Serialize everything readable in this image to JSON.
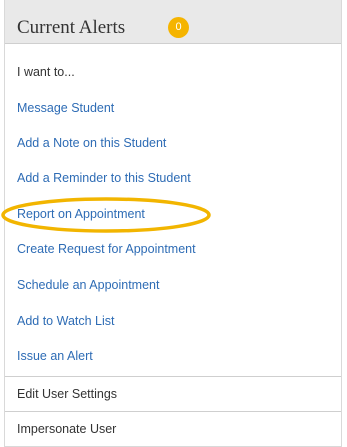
{
  "header": {
    "title": "Current Alerts",
    "alert_count": "0",
    "badge_color": "#f5b400"
  },
  "menu": {
    "heading": "I want to...",
    "items": [
      {
        "label": "Message Student"
      },
      {
        "label": "Add a Note on this Student"
      },
      {
        "label": "Add a Reminder to this Student"
      },
      {
        "label": "Report on Appointment",
        "highlighted": true
      },
      {
        "label": "Create Request for Appointment"
      },
      {
        "label": "Schedule an Appointment"
      },
      {
        "label": "Add to Watch List"
      },
      {
        "label": "Issue an Alert"
      }
    ]
  },
  "footer": {
    "items": [
      {
        "label": "Edit User Settings"
      },
      {
        "label": "Impersonate User"
      }
    ]
  },
  "colors": {
    "link": "#2e6cb5",
    "header_bg": "#e9e9e9",
    "highlight_ring": "#f2b500"
  }
}
